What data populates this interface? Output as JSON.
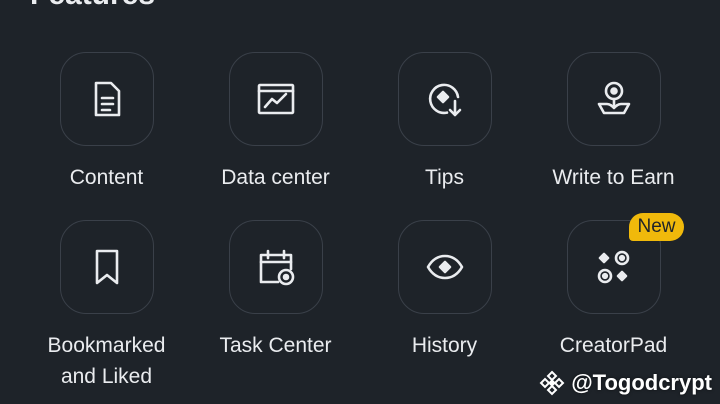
{
  "section": {
    "title": "Features"
  },
  "features": [
    {
      "label": "Content",
      "icon": "document-icon"
    },
    {
      "label": "Data center",
      "icon": "chart-icon"
    },
    {
      "label": "Tips",
      "icon": "tips-icon"
    },
    {
      "label": "Write to Earn",
      "icon": "earn-icon"
    },
    {
      "label": "Bookmarked\nand Liked",
      "icon": "bookmark-icon"
    },
    {
      "label": "Task Center",
      "icon": "calendar-icon"
    },
    {
      "label": "History",
      "icon": "eye-icon"
    },
    {
      "label": "CreatorPad",
      "icon": "creatorpad-icon",
      "badge": "New"
    }
  ],
  "watermark": {
    "text": "@Togodcrypt"
  },
  "colors": {
    "background": "#1e2329",
    "text": "#eaecef",
    "border": "#3a4049",
    "accent": "#f0b90b"
  }
}
